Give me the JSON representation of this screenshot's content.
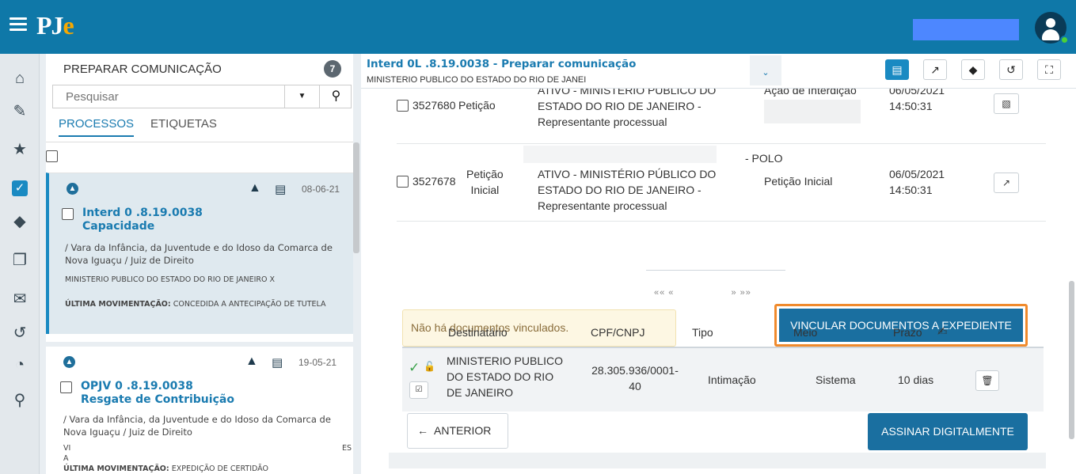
{
  "header": {
    "logo_text": "PJ",
    "logo_accent": "e",
    "brand_color": "#0f78a8",
    "accent_color": "#f7a800"
  },
  "leftnav": {
    "icons": [
      "home-icon",
      "pencil-icon",
      "star-icon",
      "checkbox-icon",
      "tags-icon",
      "copy-icon",
      "envelope-icon",
      "history-icon",
      "pie-chart-icon",
      "search-icon"
    ]
  },
  "panel": {
    "title": "PREPARAR COMUNICAÇÃO",
    "count": "7",
    "search_placeholder": "Pesquisar",
    "tabs": [
      "PROCESSOS",
      "ETIQUETAS"
    ],
    "cards": [
      {
        "date": "08-06-21",
        "title_line1": "Interd 0          .8.19.0038",
        "title_line2": "Capacidade",
        "desc": "/ Vara da Infância, da Juventude e do Idoso da Comarca de Nova Iguaçu / Juiz de Direito",
        "parties": "MINISTERIO PUBLICO DO ESTADO DO RIO DE JANEIRO X",
        "last_move_label": "ÚLTIMA MOVIMENTAÇÃO:",
        "last_move": "CONCEDIDA A ANTECIPAÇÃO DE TUTELA"
      },
      {
        "date": "19-05-21",
        "title_line1": "OPJV 0          .8.19.0038",
        "title_line2": "Resgate de Contribuição",
        "desc": "/ Vara da Infância, da Juventude e do Idoso da Comarca de Nova Iguaçu / Juiz de Direito",
        "parties_a": "VI",
        "parties_b": "ES",
        "parties_c": "A",
        "last_move_label": "ÚLTIMA MOVIMENTAÇÃO:",
        "last_move": "EXPEDIÇÃO DE CERTIDÃO"
      }
    ]
  },
  "main": {
    "title": "Interd 0L          .8.19.0038 - Preparar comunicação",
    "subtitle": "MINISTERIO PUBLICO DO ESTADO DO RIO DE JANEI",
    "documents": [
      {
        "id": "3527680",
        "type": "Petição",
        "author_l1": "ATIVO - MINISTÉRIO PÚBLICO DO",
        "author_l2": "ESTADO DO RIO DE JANEIRO -",
        "author_l3": "Representante processual",
        "class": "Ação de Interdição",
        "date": "06/05/2021",
        "time": "14:50:31"
      },
      {
        "id": "3527678",
        "type_l1": "Petição",
        "type_l2": "Inicial",
        "author_l0": "- POLO",
        "author_l1": "ATIVO - MINISTÉRIO PÚBLICO DO",
        "author_l2": "ESTADO DO RIO DE JANEIRO -",
        "author_l3": "Representante processual",
        "class": "Petição Inicial",
        "date": "06/05/2021",
        "time": "14:50:31"
      }
    ],
    "pager": {
      "first": "«« «",
      "last": "» »»"
    },
    "no_docs_text": "Não há documentos vinculados.",
    "vincular_label": "VINCULAR DOCUMENTOS A EXPEDIENTE",
    "table_headers": {
      "dest": "Destinatário",
      "cpf": "CPF/CNPJ",
      "tipo": "Tipo",
      "meio": "Meio",
      "prazo": "Prazo"
    },
    "recipient": {
      "name_l1": "MINISTERIO PUBLICO",
      "name_l2": "DO ESTADO DO RIO",
      "name_l3": "DE JANEIRO",
      "cpf_l1": "28.305.936/0001-",
      "cpf_l2": "40",
      "tipo": "Intimação",
      "meio": "Sistema",
      "prazo": "10 dias"
    },
    "anterior_label": "ANTERIOR",
    "assinar_label": "ASSINAR DIGITALMENTE"
  }
}
